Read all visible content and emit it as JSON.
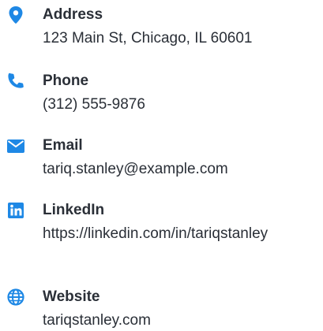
{
  "contacts": {
    "address": {
      "icon": "map-pin-icon",
      "label": "Address",
      "value": "123 Main St, Chicago, IL 60601"
    },
    "phone": {
      "icon": "phone-icon",
      "label": "Phone",
      "value": "(312) 555-9876"
    },
    "email": {
      "icon": "envelope-icon",
      "label": "Email",
      "value": "tariq.stanley@example.com"
    },
    "linkedin": {
      "icon": "linkedin-icon",
      "label": "LinkedIn",
      "value": "https://linkedin.com/in/tariqstanley"
    },
    "website": {
      "icon": "globe-icon",
      "label": "Website",
      "value": "tariqstanley.com"
    }
  },
  "colors": {
    "icon_accent": "#1e88e5",
    "text": "#2a2f37"
  }
}
